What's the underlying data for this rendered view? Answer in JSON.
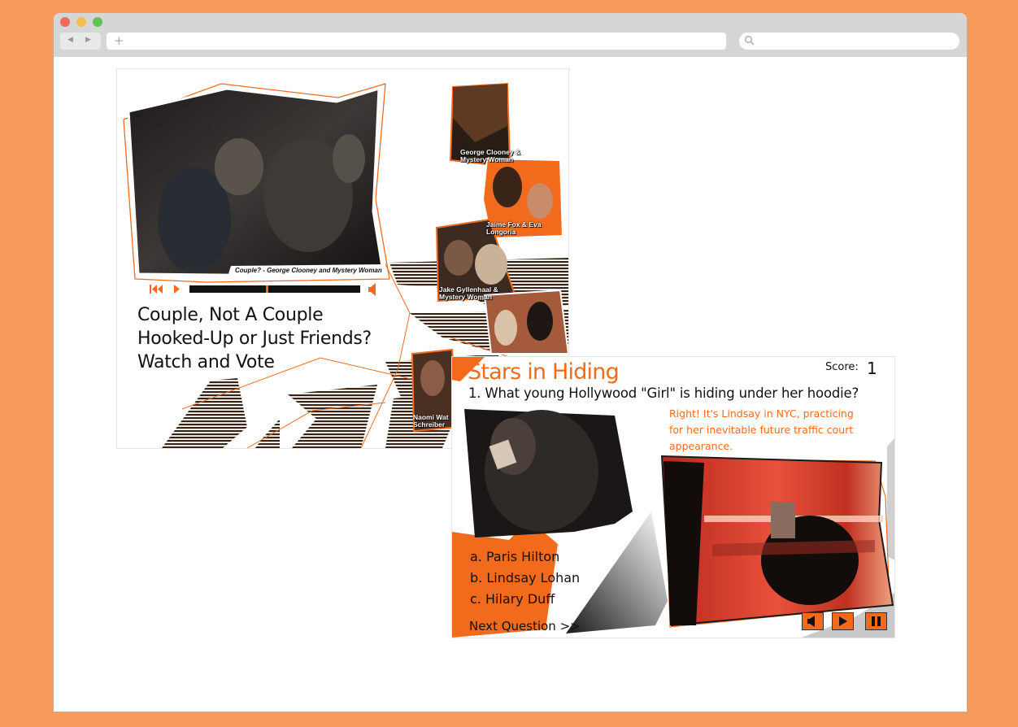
{
  "page1": {
    "video_caption": "Couple? - George Clooney and Mystery Woman",
    "headline": [
      "Couple, Not A Couple",
      "Hooked-Up or Just Friends?",
      "Watch and Vote"
    ],
    "thumbnails": [
      {
        "line1": "George Clooney &",
        "line2": "Mystery Woman"
      },
      {
        "line1": "Jaime Fox & Eva",
        "line2": "Longoria"
      },
      {
        "line1": "Jake Gyllenhaal &",
        "line2": "Mystery Woman"
      },
      {
        "line1": "Naomi Wat",
        "line2": "Schreiber"
      }
    ]
  },
  "quiz": {
    "title": "Stars in Hiding",
    "score_label": "Score:",
    "score_value": "1",
    "question": "1. What young Hollywood \"Girl\" is hiding under her hoodie?",
    "answer_text": "Right! It's Lindsay in NYC, practicing for her inevitable future traffic court appearance.",
    "options": [
      "a. Paris Hilton",
      "b. Lindsay Lohan",
      "c. Hilary Duff"
    ],
    "next": "Next Question >>"
  },
  "colors": {
    "accent": "#f26b1d",
    "background": "#f79a5c"
  },
  "icons": [
    "rewind-icon",
    "play-icon",
    "volume-icon",
    "pause-icon",
    "search-icon"
  ]
}
